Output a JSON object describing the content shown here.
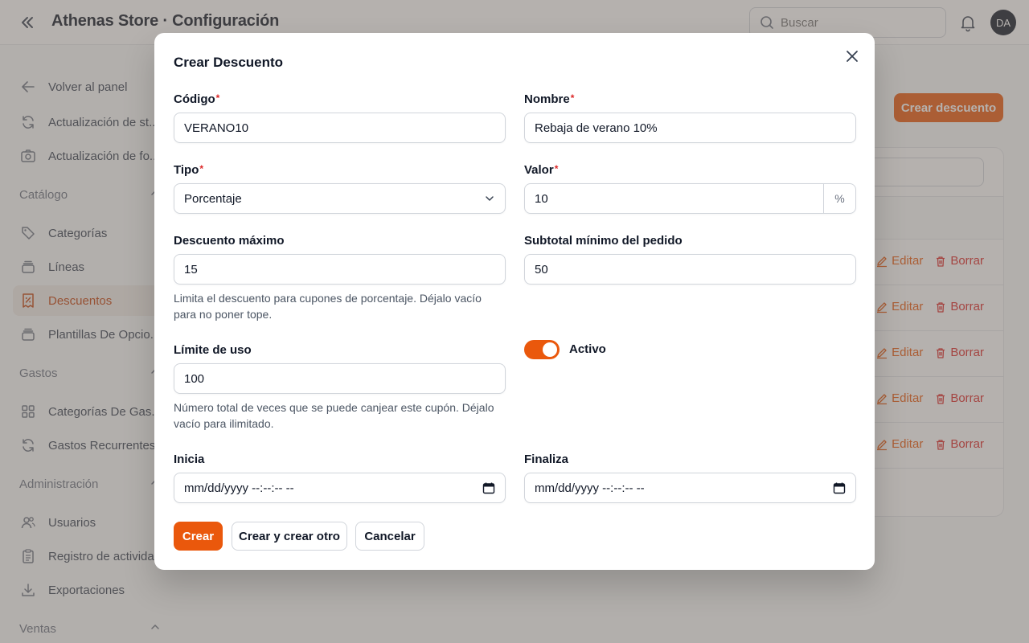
{
  "header": {
    "title": "Athenas Store · Configuración",
    "search_placeholder": "Buscar",
    "avatar_initials": "DA"
  },
  "sidebar": {
    "back_label": "Volver al panel",
    "top_items": [
      {
        "label": "Actualización de st...",
        "icon": "refresh-icon"
      },
      {
        "label": "Actualización de fo...",
        "icon": "camera-icon"
      }
    ],
    "groups": [
      {
        "label": "Catálogo",
        "items": [
          {
            "label": "Categorías",
            "icon": "tag-icon"
          },
          {
            "label": "Líneas",
            "icon": "stack-icon"
          },
          {
            "label": "Descuentos",
            "icon": "receipt-percent-icon",
            "active": true
          },
          {
            "label": "Plantillas De Opcio...",
            "icon": "stack-icon"
          }
        ]
      },
      {
        "label": "Gastos",
        "items": [
          {
            "label": "Categorías De Gas...",
            "icon": "grid-icon"
          },
          {
            "label": "Gastos Recurrentes",
            "icon": "refresh-icon"
          }
        ]
      },
      {
        "label": "Administración",
        "items": [
          {
            "label": "Usuarios",
            "icon": "users-icon"
          },
          {
            "label": "Registro de activida...",
            "icon": "clipboard-icon"
          },
          {
            "label": "Exportaciones",
            "icon": "download-icon"
          }
        ]
      },
      {
        "label": "Ventas",
        "items": []
      }
    ]
  },
  "main": {
    "create_button": "Crear descuento",
    "row_actions": {
      "edit": "Editar",
      "delete": "Borrar"
    }
  },
  "modal": {
    "title": "Crear Descuento",
    "required_mark": "*",
    "fields": {
      "codigo": {
        "label": "Código",
        "value": "VERANO10"
      },
      "nombre": {
        "label": "Nombre",
        "value": "Rebaja de verano 10%"
      },
      "tipo": {
        "label": "Tipo",
        "value": "Porcentaje"
      },
      "valor": {
        "label": "Valor",
        "value": "10",
        "suffix": "%"
      },
      "descuento_maximo": {
        "label": "Descuento máximo",
        "value": "15",
        "help": "Limita el descuento para cupones de porcentaje. Déjalo vacío para no poner tope."
      },
      "subtotal_minimo": {
        "label": "Subtotal mínimo del pedido",
        "value": "50"
      },
      "limite_uso": {
        "label": "Límite de uso",
        "value": "100",
        "help": "Número total de veces que se puede canjear este cupón. Déjalo vacío para ilimitado."
      },
      "activo": {
        "label": "Activo",
        "checked": true
      },
      "inicia": {
        "label": "Inicia",
        "value": "mm/dd/yyyy --:--:-- --"
      },
      "finaliza": {
        "label": "Finaliza",
        "value": "mm/dd/yyyy --:--:-- --"
      }
    },
    "buttons": {
      "create": "Crear",
      "create_another": "Crear y crear otro",
      "cancel": "Cancelar"
    }
  },
  "colors": {
    "accent": "#ea580c",
    "danger": "#dc2626"
  }
}
